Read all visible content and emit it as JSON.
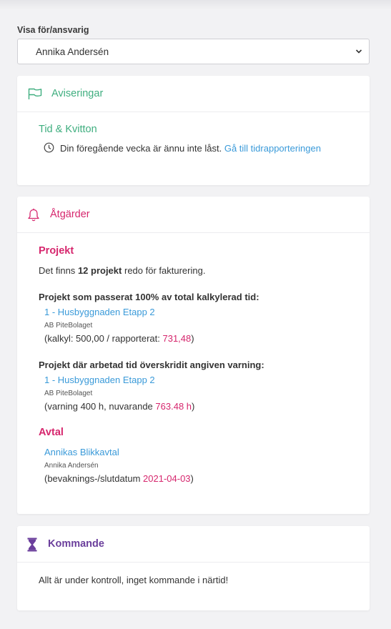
{
  "filter": {
    "label": "Visa för/ansvarig",
    "selected": "Annika Andersén"
  },
  "notifications": {
    "title": "Aviseringar",
    "section_title": "Tid & Kvitton",
    "message": "Din föregående vecka är ännu inte låst.",
    "link": "Gå till tidrapporteringen"
  },
  "actions": {
    "title": "Åtgärder",
    "projects": {
      "title": "Projekt",
      "summary_prefix": "Det finns",
      "summary_count": "12 projekt",
      "summary_suffix": "redo för fakturering.",
      "over_budget": {
        "heading": "Projekt som passerat 100% av total kalkylerad tid:",
        "project_link": "1 - Husbyggnaden Etapp 2",
        "customer": "AB PiteBolaget",
        "detail_prefix": "(kalkyl: 500,00 / rapporterat:",
        "detail_value": "731,48",
        "detail_suffix": ")"
      },
      "over_warning": {
        "heading": "Projekt där arbetad tid överskridit angiven varning:",
        "project_link": "1 - Husbyggnaden Etapp 2",
        "customer": "AB PiteBolaget",
        "detail_prefix": "(varning 400 h, nuvarande",
        "detail_value": "763.48 h",
        "detail_suffix": ")"
      }
    },
    "agreements": {
      "title": "Avtal",
      "agreement_link": "Annikas Blikkavtal",
      "owner": "Annika Andersén",
      "detail_prefix": "(bevaknings-/slutdatum",
      "detail_value": "2021-04-03",
      "detail_suffix": ")"
    }
  },
  "upcoming": {
    "title": "Kommande",
    "message": "Allt är under kontroll, inget kommande i närtid!"
  },
  "colors": {
    "green": "#3fae7f",
    "pink": "#d6266d",
    "purple": "#6b3f9c",
    "link": "#3a9ad9"
  },
  "icons": [
    "flag-icon",
    "clock-icon",
    "bell-icon",
    "hourglass-icon",
    "chevron-down-icon"
  ]
}
